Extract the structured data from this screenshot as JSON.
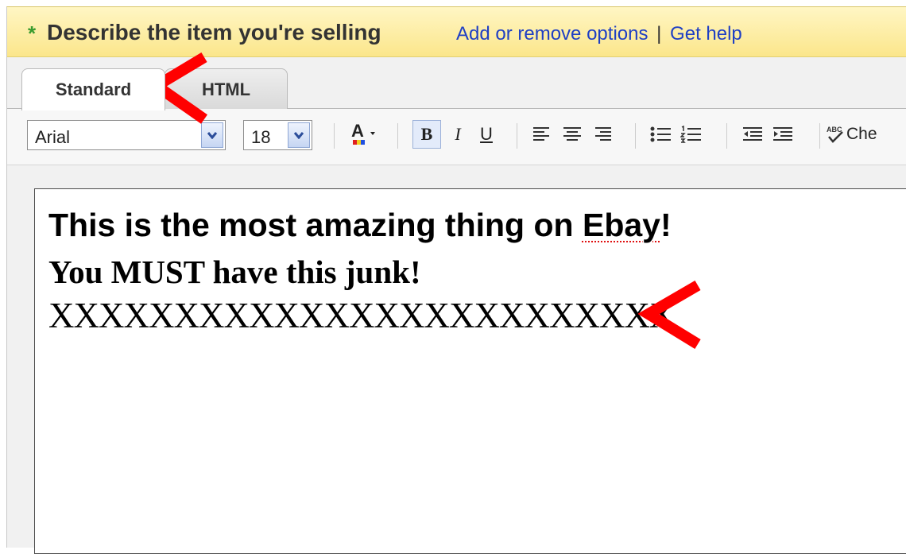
{
  "header": {
    "required_marker": "*",
    "title": "Describe the item you're selling",
    "link_options": "Add or remove options",
    "separator": "|",
    "link_help": "Get help"
  },
  "tabs": [
    {
      "label": "Standard",
      "active": true
    },
    {
      "label": "HTML",
      "active": false
    }
  ],
  "toolbar": {
    "font_family": "Arial",
    "font_size": "18",
    "bold_label": "B",
    "italic_label": "I",
    "underline_label": "U",
    "spell_label": "Che",
    "icons": [
      "font-color-icon",
      "align-left-icon",
      "align-center-icon",
      "align-right-icon",
      "bullet-list-icon",
      "numbered-list-icon",
      "outdent-icon",
      "indent-icon",
      "spellcheck-icon"
    ]
  },
  "editor": {
    "line1_before": "This is the most amazing thing on ",
    "line1_spell": "Ebay",
    "line1_after": "!",
    "line2": "You MUST have this junk!",
    "line3": "XXXXXXXXXXXXXXXXXXXXXXXXX"
  },
  "annotations": {
    "arrow_color": "#ff0000"
  },
  "colors": {
    "header_bg": "#fbe68b",
    "link": "#1f3fc4",
    "required": "#3a9b2e"
  }
}
